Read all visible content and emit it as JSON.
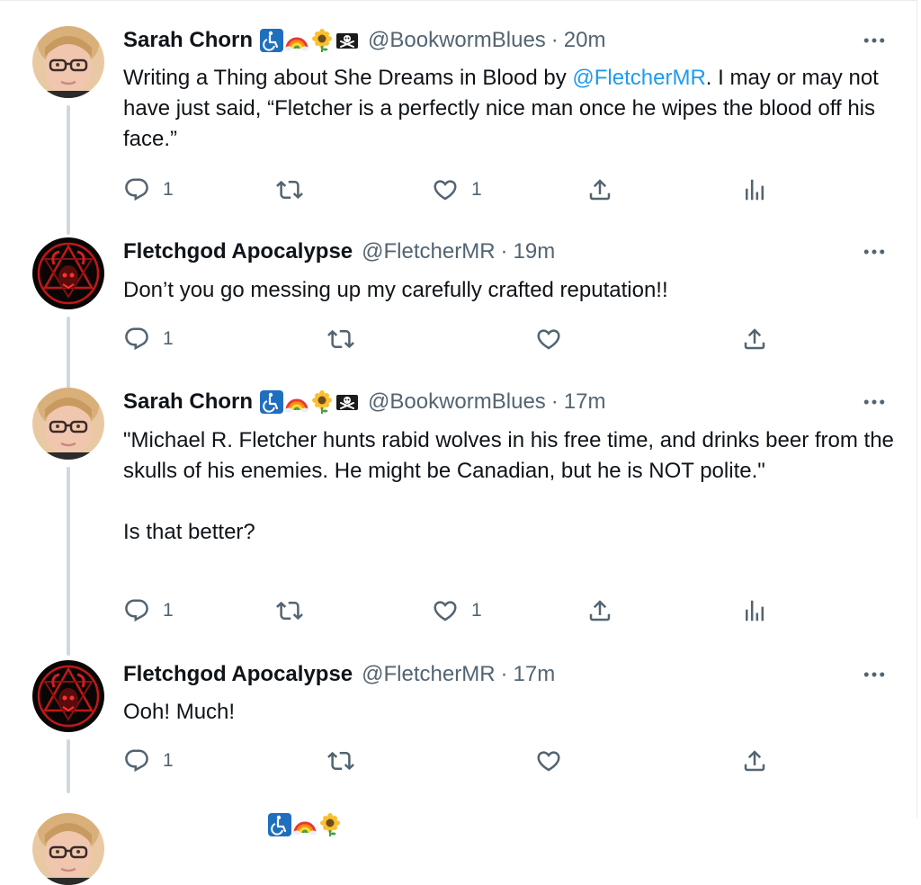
{
  "tweets": [
    {
      "name": "Sarah Chorn",
      "emojis": [
        "wheelchair-icon",
        "rainbow-icon",
        "sunflower-icon",
        "pirate-flag-icon"
      ],
      "handle": "@BookwormBlues",
      "separator": "·",
      "time": "20m",
      "text_before": "Writing a Thing about She Dreams in Blood by ",
      "mention": "@FletcherMR",
      "text_after": ". I may or may not have just said, “Fletcher is a perfectly nice man once he wipes the blood off his face.”",
      "reply_count": "1",
      "like_count": "1",
      "has_analytics": true
    },
    {
      "name": "Fletchgod Apocalypse",
      "handle": "@FletcherMR",
      "separator": "·",
      "time": "19m",
      "text": "Don’t you go messing up my carefully crafted reputation!!",
      "reply_count": "1",
      "like_count": "",
      "has_analytics": false
    },
    {
      "name": "Sarah Chorn",
      "emojis": [
        "wheelchair-icon",
        "rainbow-icon",
        "sunflower-icon",
        "pirate-flag-icon"
      ],
      "handle": "@BookwormBlues",
      "separator": "·",
      "time": "17m",
      "text_p1": "\"Michael R. Fletcher hunts rabid wolves in his free time, and drinks beer from the skulls of his enemies. He might be Canadian, but he is NOT polite.\"",
      "text_p2": "Is that better?",
      "reply_count": "1",
      "like_count": "1",
      "has_analytics": true
    },
    {
      "name": "Fletchgod Apocalypse",
      "handle": "@FletcherMR",
      "separator": "·",
      "time": "17m",
      "text": "Ooh! Much!",
      "reply_count": "1",
      "like_count": "",
      "has_analytics": false
    }
  ],
  "colors": {
    "mention": "#1d9bf0",
    "secondary_text": "#536471",
    "thread_line": "#cfd9de"
  }
}
